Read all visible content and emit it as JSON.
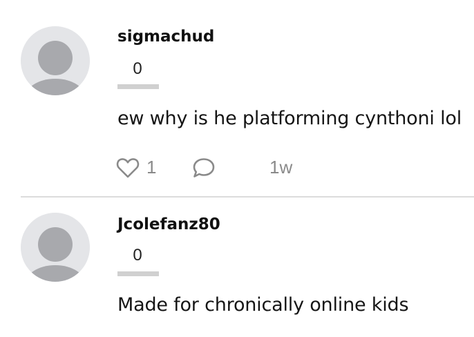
{
  "comments": [
    {
      "username": "sigmachud",
      "vote_count": "0",
      "text": "ew why is he platforming cynthoni lol",
      "like_count": "1",
      "timestamp": "1w"
    },
    {
      "username": "Jcolefanz80",
      "vote_count": "0",
      "text": "Made for chronically online kids"
    }
  ],
  "colors": {
    "avatar_bg": "#e4e5e8",
    "avatar_figure": "#a8a9ad",
    "divider": "#dcdcdc",
    "meta_text": "#8a8a8a"
  },
  "icons": {
    "like": "heart-icon",
    "reply": "speech-bubble-icon"
  }
}
